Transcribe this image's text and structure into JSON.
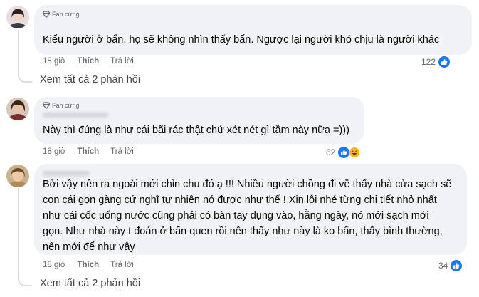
{
  "comments": [
    {
      "badge": "Fan cứng",
      "text_lines": [
        "Kiểu người ở bẩn, họ sẽ không nhìn thấy bẩn. Ngược lại người khó chịu là người khác"
      ],
      "time": "18 giờ",
      "like_label": "Thích",
      "reply_label": "Trả lời",
      "reaction_count": "122",
      "reactions": [
        "like-icon"
      ]
    },
    {
      "badge": "Fan cứng",
      "text_lines": [
        "Này thì đúng là như cái bãi rác thật chứ xét nét gì tầm này nữa =)))"
      ],
      "time": "18 giờ",
      "like_label": "Thích",
      "reply_label": "Trả lời",
      "reaction_count": "62",
      "reactions": [
        "like-icon",
        "haha-icon"
      ]
    },
    {
      "badge": "",
      "text_lines": [
        "Bởi vậy nên ra ngoài mới chỉn chu đó ạ !!! Nhiều người chồng đi về thấy nhà cửa sạch sẽ",
        "con cái gọn gàng cứ nghĩ tự nhiên nó được như thế ! Xin lỗi nhé từng chi tiết nhỏ nhất",
        "như cái cốc uống nước cũng phải có bàn tay đụng vào, hằng ngày, nó mới sạch mới",
        "gọn. Như nhà này t đoán ở bẩn quen rồi nên thấy như này là ko bẩn, thấy bình thường,",
        "nên mới để như vậy"
      ],
      "time": "18 giờ",
      "like_label": "Thích",
      "reply_label": "Trả lời",
      "reaction_count": "34",
      "reactions": [
        "like-icon"
      ]
    }
  ],
  "view_replies": [
    "Xem tất cả 2 phản hồi",
    "Xem tất cả 2 phản hồi"
  ],
  "colors": {
    "bubble": "#f0f2f5",
    "secondary_text": "#65676b",
    "like_blue": "#1877f2",
    "haha_yellow": "#f7b125",
    "thread_line": "#dadde1"
  }
}
